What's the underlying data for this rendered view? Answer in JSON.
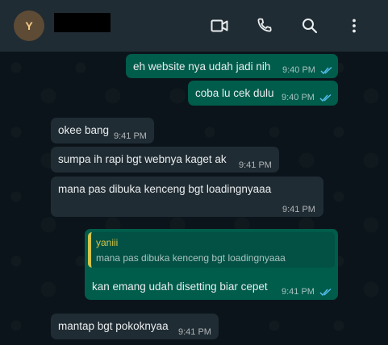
{
  "header": {
    "avatar_initial": "Y"
  },
  "messages": [
    {
      "dir": "out",
      "text": "eh website nya udah jadi nih",
      "time": "9:40 PM"
    },
    {
      "dir": "out",
      "text": "coba lu cek dulu",
      "time": "9:40 PM"
    },
    {
      "dir": "in",
      "text": "okee bang",
      "time": "9:41 PM"
    },
    {
      "dir": "in",
      "text": "sumpa ih rapi bgt webnya kaget ak",
      "time": "9:41 PM"
    },
    {
      "dir": "in",
      "text": "mana pas dibuka kenceng bgt loadingnyaaa",
      "time": "9:41 PM"
    },
    {
      "dir": "out",
      "reply_name": "yaniii",
      "reply_text": "mana pas dibuka kenceng bgt loadingnyaaa",
      "text": "kan emang udah disetting biar cepet",
      "time": "9:41 PM"
    },
    {
      "dir": "in",
      "text": "mantap bgt pokoknyaa",
      "time": "9:41 PM"
    }
  ],
  "colors": {
    "header_bg": "#202c33",
    "chat_bg": "#0b141a",
    "outgoing_bubble": "#005c4b",
    "incoming_bubble": "#202c33",
    "read_ticks": "#53bdeb",
    "quote_accent": "#d3c44a"
  },
  "icons": [
    "video-call-icon",
    "voice-call-icon",
    "search-icon",
    "menu-icon",
    "read-receipt-icon"
  ]
}
